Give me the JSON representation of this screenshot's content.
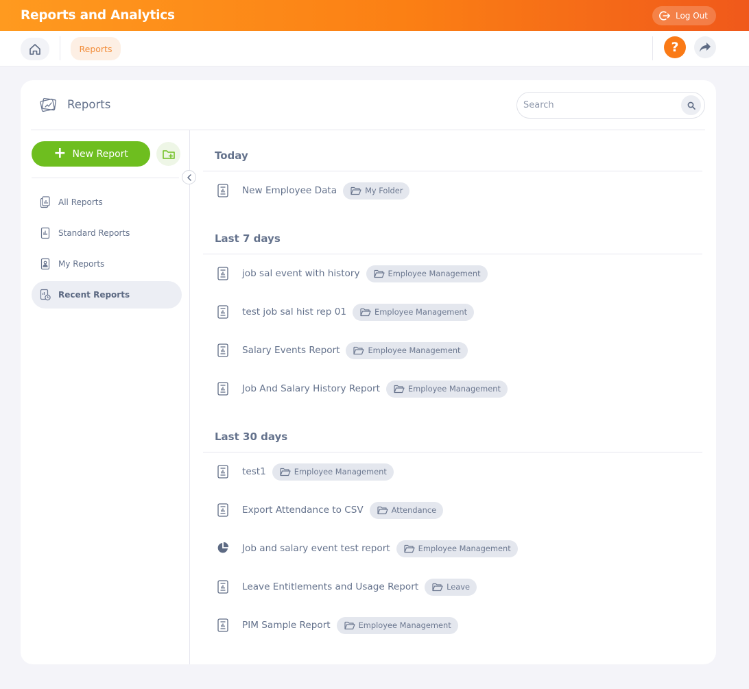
{
  "header": {
    "title": "Reports and Analytics",
    "logout_label": "Log Out"
  },
  "breadcrumb": {
    "current": "Reports"
  },
  "help_label": "?",
  "card": {
    "title": "Reports",
    "search_placeholder": "Search"
  },
  "sidebar": {
    "new_report_label": "New Report",
    "items": [
      {
        "label": "All Reports",
        "icon": "all-reports-icon",
        "active": false
      },
      {
        "label": "Standard Reports",
        "icon": "standard-reports-icon",
        "active": false
      },
      {
        "label": "My Reports",
        "icon": "my-reports-icon",
        "active": false
      },
      {
        "label": "Recent Reports",
        "icon": "recent-reports-icon",
        "active": true
      }
    ]
  },
  "sections": [
    {
      "title": "Today",
      "reports": [
        {
          "name": "New Employee Data",
          "folder": "My Folder",
          "icon": "report-icon"
        }
      ]
    },
    {
      "title": "Last 7 days",
      "reports": [
        {
          "name": "job sal event with history",
          "folder": "Employee Management",
          "icon": "report-icon"
        },
        {
          "name": "test job sal hist rep 01",
          "folder": "Employee Management",
          "icon": "report-icon"
        },
        {
          "name": "Salary Events Report",
          "folder": "Employee Management",
          "icon": "report-icon"
        },
        {
          "name": "Job And Salary History Report",
          "folder": "Employee Management",
          "icon": "report-icon"
        }
      ]
    },
    {
      "title": "Last 30 days",
      "reports": [
        {
          "name": "test1",
          "folder": "Employee Management",
          "icon": "report-icon"
        },
        {
          "name": "Export Attendance to CSV",
          "folder": "Attendance",
          "icon": "report-icon"
        },
        {
          "name": "Job and salary event test report",
          "folder": "Employee Management",
          "icon": "pie-chart-icon"
        },
        {
          "name": "Leave Entitlements and Usage Report",
          "folder": "Leave",
          "icon": "report-icon"
        },
        {
          "name": "PIM Sample Report",
          "folder": "Employee Management",
          "icon": "report-icon"
        }
      ]
    }
  ],
  "colors": {
    "brand_orange": "#fb7f14",
    "accent_green": "#6ebe1f",
    "text": "#64728c"
  }
}
